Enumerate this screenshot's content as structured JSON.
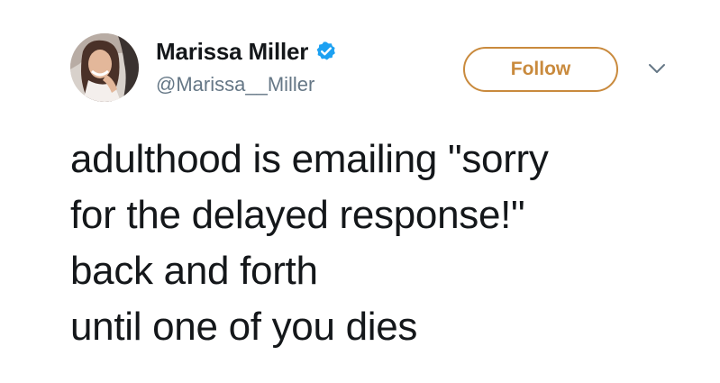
{
  "tweet": {
    "author": {
      "display_name": "Marissa Miller",
      "handle": "@Marissa__Miller",
      "verified": true,
      "avatar_icon": "profile-photo"
    },
    "follow_label": "Follow",
    "menu_icon": "chevron-down-icon",
    "text_lines": [
      "adulthood is emailing \"sorry",
      "for the delayed response!\"",
      "back and forth",
      "until one of you dies"
    ]
  },
  "colors": {
    "text": "#14171a",
    "secondary_text": "#657786",
    "verified_badge": "#1da1f2",
    "follow_accent": "#c98a3d",
    "chevron": "#657786"
  }
}
